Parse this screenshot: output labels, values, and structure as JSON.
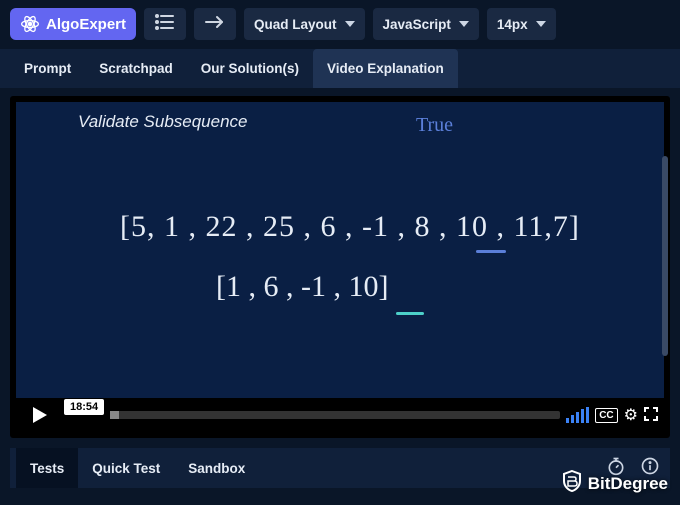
{
  "brand": {
    "name": "AlgoExpert"
  },
  "toolbar": {
    "layout_label": "Quad Layout",
    "language_label": "JavaScript",
    "fontsize_label": "14px"
  },
  "tabs": {
    "prompt": "Prompt",
    "scratchpad": "Scratchpad",
    "solutions": "Our Solution(s)",
    "video": "Video Explanation"
  },
  "whiteboard": {
    "title": "Validate Subsequence",
    "annotation": "True",
    "array1": "[5, 1 , 22 , 25 , 6 , -1 , 8 , 10 , 11,7]",
    "array2": "[1 , 6 , -1 , 10]"
  },
  "player": {
    "timestamp": "18:54",
    "cc": "CC"
  },
  "bottom_tabs": {
    "tests": "Tests",
    "quick_test": "Quick Test",
    "sandbox": "Sandbox"
  },
  "watermark": {
    "text": "BitDegree"
  }
}
